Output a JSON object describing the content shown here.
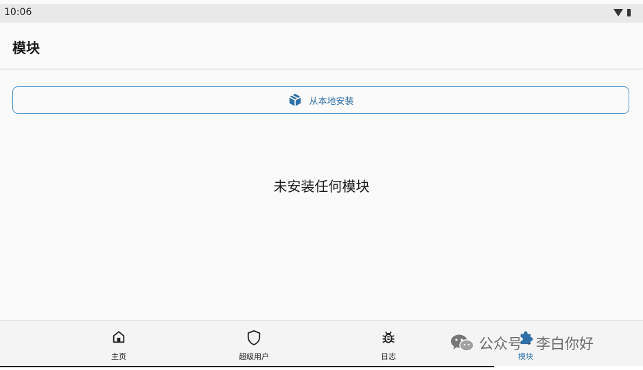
{
  "status_bar": {
    "time": "10:06",
    "icons": [
      "wifi-icon",
      "battery-icon"
    ]
  },
  "app_bar": {
    "title": "模块"
  },
  "install_button": {
    "icon": "package-icon",
    "label": "从本地安装"
  },
  "empty_state": {
    "message": "未安装任何模块"
  },
  "bottom_nav": {
    "items": [
      {
        "label": "主页",
        "icon": "home-icon",
        "active": false
      },
      {
        "label": "超级用户",
        "icon": "shield-icon",
        "active": false
      },
      {
        "label": "日志",
        "icon": "bug-icon",
        "active": false
      },
      {
        "label": "模块",
        "icon": "puzzle-icon",
        "active": true
      }
    ]
  },
  "watermark": {
    "text": "公众号 · 李白你好",
    "icon": "wechat-icon"
  },
  "colors": {
    "accent": "#2f6fa8",
    "button_border": "#4a90c8",
    "background": "#fafafa",
    "status_bar": "#e9e9e9",
    "nav_background": "#f4f4f4",
    "text": "#1a1a1a"
  }
}
